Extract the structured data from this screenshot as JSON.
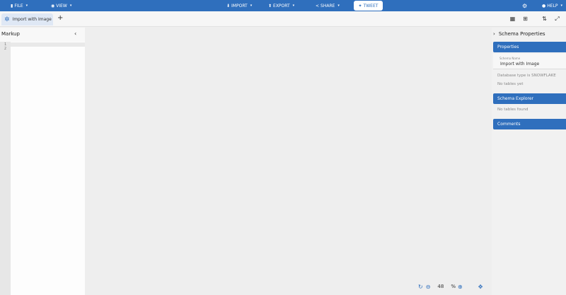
{
  "topbar": {
    "file": "FILE",
    "view": "VIEW",
    "import": "IMPORT",
    "export": "EXPORT",
    "share": "SHARE",
    "tweet": "TWEET",
    "help": "HELP"
  },
  "tabs": {
    "active_tab": "Import with Image",
    "add": "+"
  },
  "markup": {
    "title": "Markup",
    "line_numbers": [
      "1",
      "2"
    ]
  },
  "schema": {
    "title": "Schema Properties",
    "properties_header": "Properties",
    "schema_name_label": "Schema Name",
    "schema_name_value": "Import with Image",
    "database_type_text": "Database type is SNOWFLAKE",
    "no_tables_text": "No tables yet",
    "explorer_header": "Schema Explorer",
    "no_tables_found": "No tables found",
    "comments_header": "Comments"
  },
  "zoom": {
    "value": "48",
    "unit": "%"
  },
  "icons": {
    "file": "file-icon",
    "view": "eye-icon",
    "import": "download-icon",
    "export": "upload-icon",
    "share": "share-icon",
    "tweet": "twitter-icon",
    "settings": "gear-icon",
    "help": "help-icon"
  },
  "colors": {
    "brand": "#2f6fbd",
    "canvas": "#eeeeee"
  }
}
